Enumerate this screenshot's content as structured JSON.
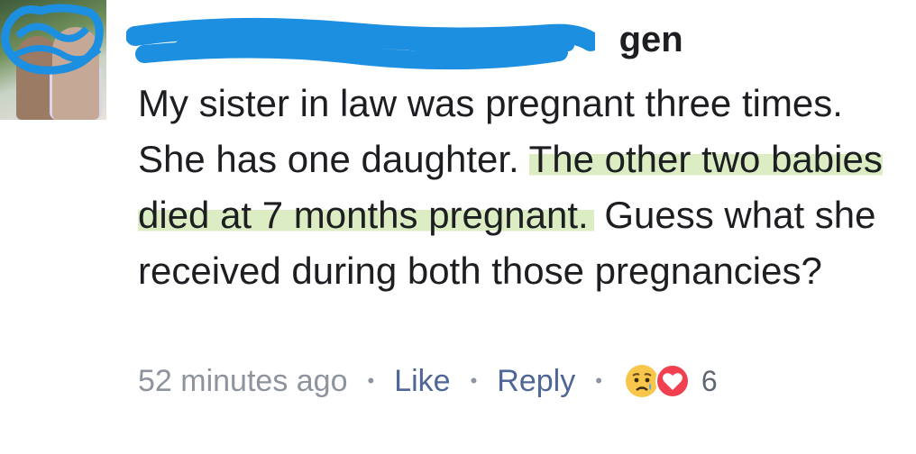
{
  "comment": {
    "author_visible": "gen",
    "text_part1": "My sister in law was pregnant three times. She has one daughter. ",
    "text_highlight": "The other two babies died at 7 months pregnant.",
    "text_part2": " Guess what she received during both those pregnancies?",
    "highlight_color": "#dcedc4"
  },
  "meta": {
    "timestamp": "52 minutes ago",
    "like_label": "Like",
    "reply_label": "Reply",
    "separator": "•",
    "reaction_icons": [
      "sad-face-icon",
      "heart-icon"
    ],
    "reaction_count": "6",
    "link_color": "#4f6796"
  },
  "redaction_color": "#1d8fe1"
}
